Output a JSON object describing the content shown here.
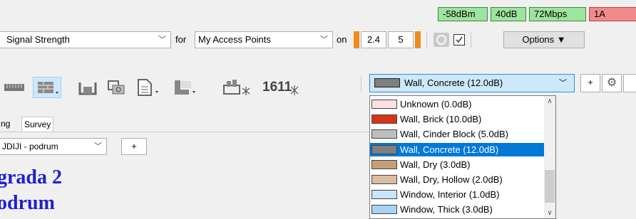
{
  "status": {
    "signal": "-58dBm",
    "snr": "40dB",
    "rate": "72Mbps",
    "extra": "1A"
  },
  "controls": {
    "metric": "Signal Strength",
    "for_label": "for",
    "ap_filter": "My Access Points",
    "on_label": "on",
    "band_24": "2.4",
    "band_5": "5",
    "options_label": "Options ▼"
  },
  "toolbar": {
    "icons": [
      "wall-ruler-icon",
      "brick-wall-icon",
      "door-icon",
      "device-icon",
      "document-icon",
      "area-icon",
      "attenuation-area-icon",
      "floor-number-icon"
    ],
    "floor_digits": "1611",
    "material_selected": "Wall, Concrete (12.0dB)",
    "add_label": "+"
  },
  "materials": [
    {
      "label": "Unknown (0.0dB)",
      "color": "#fde0e0"
    },
    {
      "label": "Wall, Brick (10.0dB)",
      "color": "#d8341a"
    },
    {
      "label": "Wall, Cinder Block (5.0dB)",
      "color": "#bebebe"
    },
    {
      "label": "Wall, Concrete (12.0dB)",
      "color": "#7f7f7f"
    },
    {
      "label": "Wall, Dry (3.0dB)",
      "color": "#c4a079"
    },
    {
      "label": "Wall, Dry, Hollow (2.0dB)",
      "color": "#d9bea0"
    },
    {
      "label": "Window, Interior (1.0dB)",
      "color": "#c9e6fb"
    },
    {
      "label": "Window, Thick (3.0dB)",
      "color": "#a8d4f5"
    }
  ],
  "selected_material_index": 3,
  "tabs": [
    "ng",
    "Survey"
  ],
  "floor": {
    "selected": "JDIJI - podrum",
    "add_label": "+"
  },
  "title": {
    "line1": "grada 2",
    "line2": "odrum"
  }
}
